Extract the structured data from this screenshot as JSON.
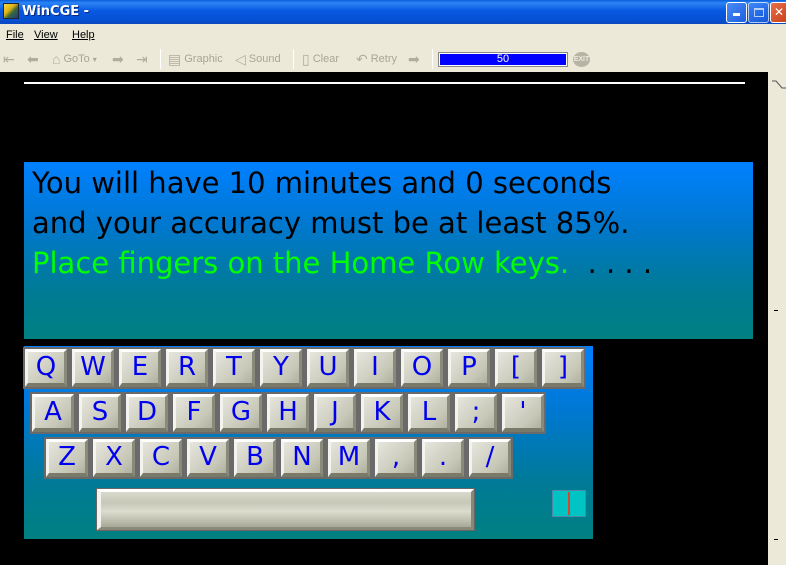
{
  "window": {
    "title": "WinCGE -",
    "icon": "app-icon",
    "controls": [
      "minimize",
      "maximize",
      "close"
    ]
  },
  "menu": {
    "items": [
      {
        "label": "File",
        "accel": "F"
      },
      {
        "label": "View",
        "accel": "V"
      },
      {
        "label": "Help",
        "accel": "H"
      }
    ]
  },
  "toolbar": {
    "first_icon": "first-page-icon",
    "back_icon": "back-arrow-icon",
    "goto_icon": "home-icon",
    "goto_label": "GoTo",
    "goto_arrow": "▾",
    "forward_icon": "forward-arrow-icon",
    "last_icon": "last-page-icon",
    "graphic_label": "Graphic",
    "sound_label": "Sound",
    "clear_label": "Clear",
    "retry_label": "Retry",
    "ok_icon": "ok-arrow-icon",
    "progress_value": 50,
    "progress_text": "50",
    "exit_label": "EXIT"
  },
  "lesson": {
    "line1": "You will have 10 minutes and 0 seconds",
    "line2": "and your accuracy must be at least 85%.",
    "line3": "Place fingers on the Home Row keys.",
    "dots": "  . . . .",
    "colors": {
      "instruction_text": "#000000",
      "prompt_text": "#00ff00",
      "panel_top": "#0080ff",
      "panel_bottom": "#008080",
      "key_label": "#0000ee"
    }
  },
  "keyboard": {
    "row1": [
      "Q",
      "W",
      "E",
      "R",
      "T",
      "Y",
      "U",
      "I",
      "O",
      "P",
      "[",
      "]"
    ],
    "row2": [
      "A",
      "S",
      "D",
      "F",
      "G",
      "H",
      "J",
      "K",
      "L",
      ";",
      "'"
    ],
    "row3": [
      "Z",
      "X",
      "C",
      "V",
      "B",
      "N",
      "M",
      ",",
      ".",
      "/"
    ]
  }
}
